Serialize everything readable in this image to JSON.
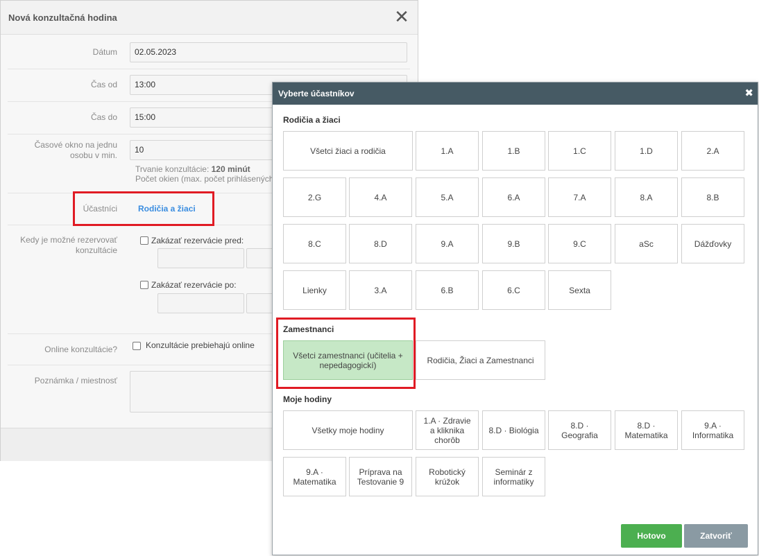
{
  "background_dialog": {
    "title": "Nová konzultačná hodina",
    "close_icon": "close-icon",
    "fields": {
      "date_label": "Dátum",
      "date_value": "02.05.2023",
      "from_label": "Čas od",
      "from_value": "13:00",
      "to_label": "Čas do",
      "to_value": "15:00",
      "window_label_line1": "Časové okno na jednu",
      "window_label_line2": "osobu v min.",
      "window_value": "10",
      "duration_prefix": "Trvanie konzultácie:",
      "duration_value": "120 minút",
      "slots_text": "Počet okien (max. počet prihlásených",
      "participants_label": "Účastníci",
      "participants_value": "Rodičia a žiaci",
      "booking_label_line1": "Kedy je možné rezervovať",
      "booking_label_line2": "konzultácie",
      "forbid_before": "Zakázať rezervácie pred:",
      "forbid_after": "Zakázať rezervácie po:",
      "online_label": "Online konzultácie?",
      "online_checkbox": "Konzultácie prebiehajú online",
      "note_label": "Poznámka / miestnosť"
    }
  },
  "modal": {
    "title": "Vyberte účastníkov",
    "close_icon": "close-icon",
    "sections": {
      "parents": {
        "title": "Rodičia a žiaci",
        "items": [
          "Všetci žiaci a rodičia",
          "1.A",
          "1.B",
          "1.C",
          "1.D",
          "2.A",
          "2.G",
          "4.A",
          "5.A",
          "6.A",
          "7.A",
          "8.A",
          "8.B",
          "8.C",
          "8.D",
          "9.A",
          "9.B",
          "9.C",
          "aSc",
          "Dážďovky",
          "Lienky",
          "3.A",
          "6.B",
          "6.C",
          "Sexta"
        ]
      },
      "staff": {
        "title": "Zamestnanci",
        "items": [
          "Všetci zamestnanci (učitelia + nepedagogickí)",
          "Rodičia, Žiaci a Zamestnanci"
        ]
      },
      "mine": {
        "title": "Moje hodiny",
        "items": [
          "Všetky moje hodiny",
          "1.A · Zdravie a kliknika chorôb",
          "8.D · Biológia",
          "8.D · Geografia",
          "8.D · Matematika",
          "9.A · Informatika",
          "9.A · Matematika",
          "Príprava na Testovanie 9",
          "Robotický krúžok",
          "Seminár z informatiky"
        ]
      }
    },
    "buttons": {
      "done": "Hotovo",
      "close": "Zatvoriť"
    },
    "colors": {
      "header": "#465a64",
      "selected": "#c6e8c6",
      "done": "#4caf50",
      "close": "#8a9aa3",
      "highlight": "#e01b24"
    }
  }
}
